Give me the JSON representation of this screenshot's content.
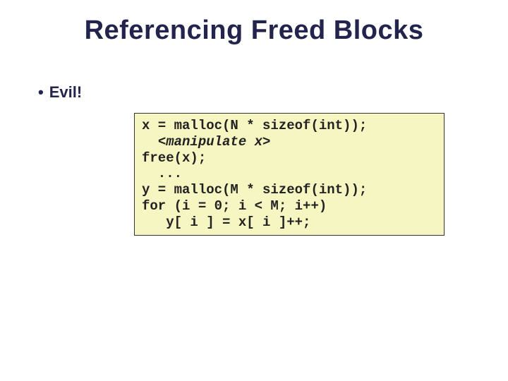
{
  "title": "Referencing Freed Blocks",
  "bullet": "Evil!",
  "code": {
    "l1": "x = malloc(N * sizeof(int));",
    "l2pre": "  ",
    "l2open": "<",
    "l2body": "manipulate x",
    "l2close": ">",
    "l3": "free(x);",
    "l4": "  ...",
    "l5": "y = malloc(M * sizeof(int));",
    "l6": "for (i = 0; i < M; i++)",
    "l7": "   y[ i ] = x[ i ]++;"
  }
}
